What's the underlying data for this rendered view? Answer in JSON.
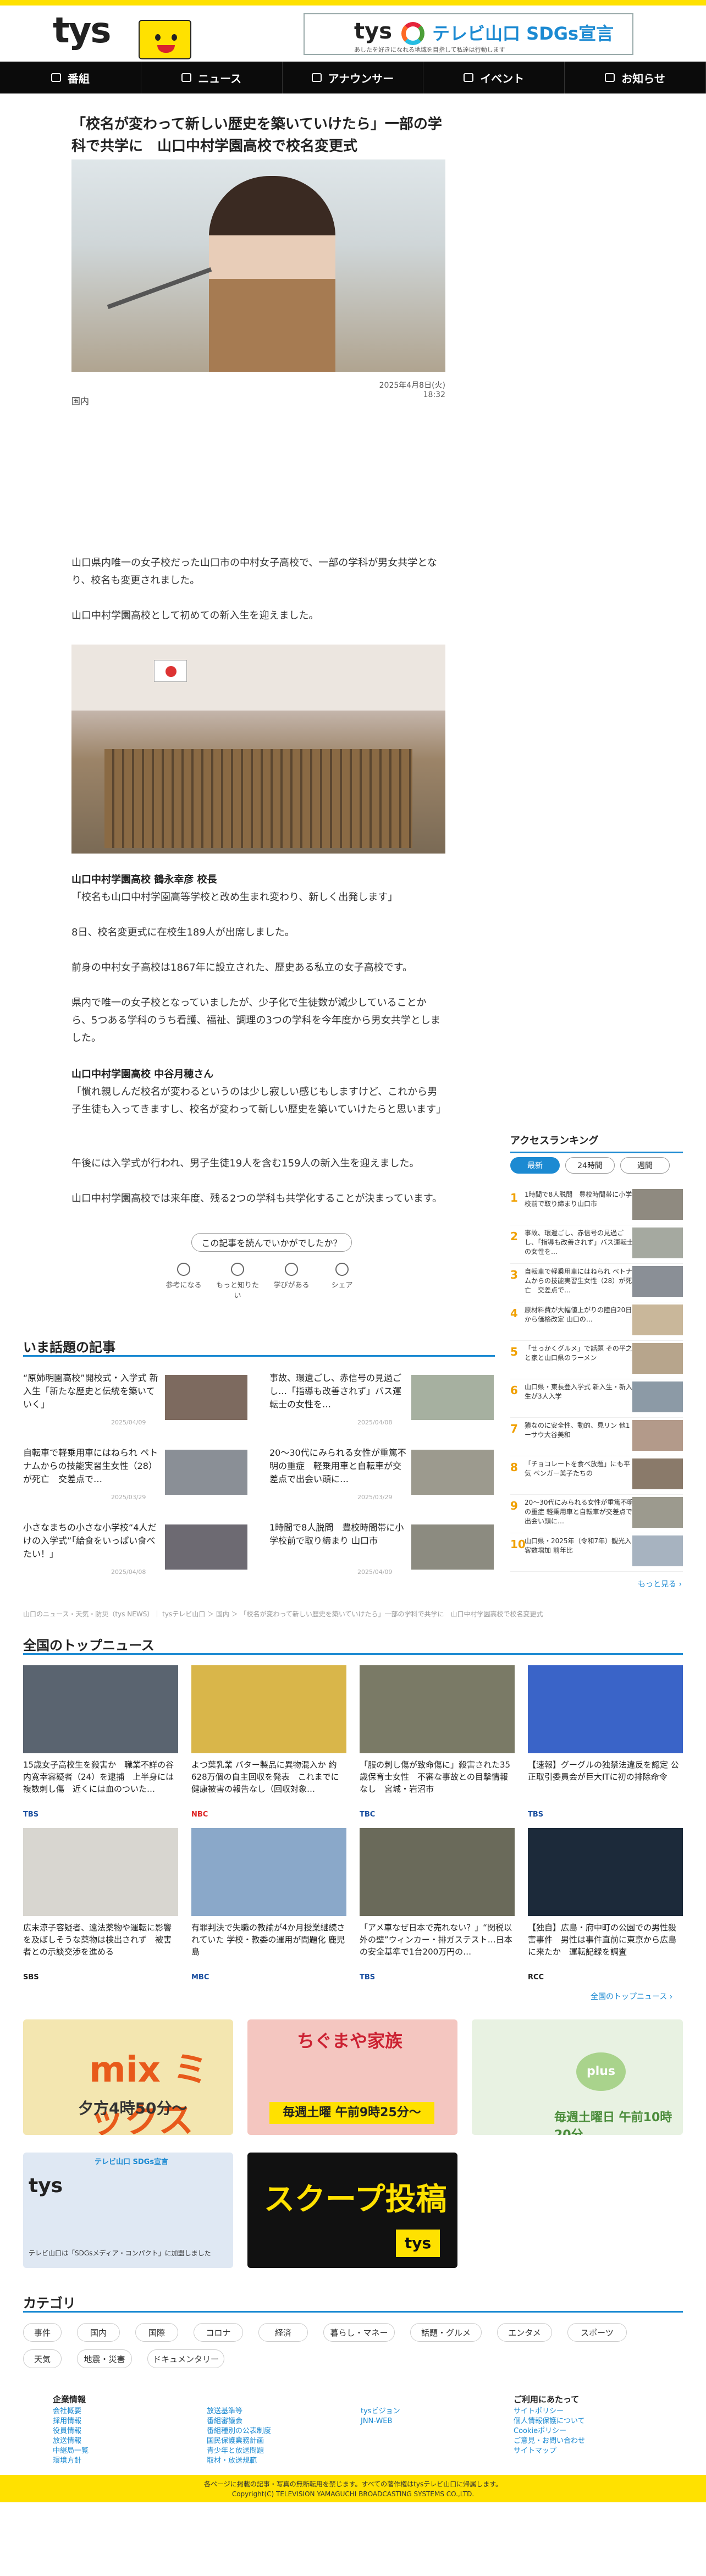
{
  "brand": {
    "logo": "tys",
    "sdgs_label": "テレビ山口 SDGs宣言",
    "sdgs_sub": "あしたを好きになれる地域を目指して私達は行動します",
    "accent": "#ffe100",
    "link": "#1c8ad2"
  },
  "nav": [
    "番組",
    "ニュース",
    "アナウンサー",
    "イベント",
    "お知らせ"
  ],
  "article": {
    "title": "「校名が変わって新しい歴史を築いていけたら」一部の学科で共学に　山口中村学園高校で校名変更式",
    "date": "2025年4月8日(火) 18:32",
    "category": "国内",
    "p1": "山口県内唯一の女子校だった山口市の中村女子高校で、一部の学科が男女共学となり、校名も変更されました。",
    "p2": "山口中村学園高校として初めての新入生を迎えました。",
    "speaker1": "山口中村学園高校 鶴永幸彦 校長",
    "q1": "「校名も山口中村学園高等学校と改め生まれ変わり、新しく出発します」",
    "p3": "8日、校名変更式に在校生189人が出席しました。",
    "p4": "前身の中村女子高校は1867年に設立された、歴史ある私立の女子高校です。",
    "p5": "県内で唯一の女子校となっていましたが、少子化で生徒数が減少していることから、5つある学科のうち看護、福祉、調理の3つの学科を今年度から男女共学としました。",
    "speaker2": "山口中村学園高校 中谷月穂さん",
    "q2": "「慣れ親しんだ校名が変わるというのは少し寂しい感じもしますけど、これから男子生徒も入ってきますし、校名が変わって新しい歴史を築いていけたらと思います」",
    "p6": "午後には入学式が行われ、男子生徒19人を含む159人の新入生を迎えました。",
    "p7": "山口中村学園高校では来年度、残る2つの学科も共学化することが決まっています。",
    "survey": "この記事を読んでいかがでしたか？",
    "reactions": [
      "参考になる",
      "もっと知りたい",
      "学びがある",
      "シェア"
    ]
  },
  "topics": {
    "title": "いま話題の記事",
    "items": [
      {
        "t": "“原姉明園高校”開校式・入学式 新入生「新たな歴史と伝統を築いていく」",
        "d": "2025/04/09"
      },
      {
        "t": "事故、環遺ごし、赤信号の見過ごし…「指導も改善されず」バス運転士の女性を…",
        "d": "2025/04/08"
      },
      {
        "t": "自転車で軽乗用車にはねられ ペトナムからの技能実習生女性（28）が死亡　交差点で…",
        "d": "2025/03/29"
      },
      {
        "t": "20～30代にみられる女性が重篤不明の重症　軽乗用車と自転車が交差点で出会い頭に…",
        "d": "2025/03/29"
      },
      {
        "t": "小さなまちの小さな小学校“4人だけの入学式”「給食をいっぱい食べたい！」",
        "d": "2025/04/08"
      },
      {
        "t": "1時間で8人脱問　豊校時間帯に小学校前で取り締まり 山口市",
        "d": "2025/04/09"
      }
    ]
  },
  "ranking": {
    "title": "アクセスランキング",
    "tabs": [
      "最新",
      "24時間",
      "週間"
    ],
    "more": "もっと見る ›",
    "items": [
      "1時間で8人脱問　豊校時間帯に小学校前で取り締まり山口市",
      "事故、環遺ごし、赤信号の見過ごし、「指導も改善されず」バス運転士の女性を…",
      "自転車で軽乗用車にはねられ ペトナムからの技能実習生女性（28）が死亡　交差点で…",
      "原材料費が大幅値上がりの陸自20日から価格改定 山口の…",
      "「せっかくグルメ」で話題 その平之と家と山口県のラーメン",
      "山口県・東長登入学式 新入生・新入生が3人入学",
      "猿なのに安全性、動的、見リン 他1ーサウ大谷美和",
      "「チョコレートを食べ放題」にも平気 ペンガー美子たちの",
      "20～30代にみられる女性が重篤不明の重症 軽乗用車と自転車が交差点で出会い頭に…",
      "山口県・2025年（令和7年）観光入客数増加 前年比"
    ]
  },
  "crumb": "山口のニュース・天気・防災（tys NEWS）｜ tysテレビ山口 ＞ 国内 ＞ 「校名が変わって新しい歴史を築いていけたら」一部の学科で共学に　山口中村学園高校で校名変更式",
  "national": {
    "title": "全国のトップニュース",
    "more": "全国のトップニュース ›",
    "items": [
      {
        "t": "15歳女子高校生を殺害か　職業不詳の谷内寛幸容疑者（24）を逮捕　上半身には複数刺し傷　近くには血のついた…",
        "s": "TBS",
        "c": "#1a4fa0"
      },
      {
        "t": "よつ葉乳業 バター製品に異物混入か 約628万個の自主回収を発表　これまでに健康被害の報告なし（回収対象…",
        "s": "NBC",
        "c": "#d22"
      },
      {
        "t": "「服の刺し傷が致命傷に」殺害された35歳保育士女性　不審な事故との目撃情報なし　宮城・岩沼市",
        "s": "TBC",
        "c": "#1a4fa0"
      },
      {
        "t": "【速報】グーグルの独禁法違反を認定 公正取引委員会が巨大ITに初の排除命令",
        "s": "TBS",
        "c": "#1a4fa0"
      },
      {
        "t": "広末涼子容疑者、遠法薬物や運転に影響を及ぼしそうな薬物は検出されず　被害者との示談交渉を進める",
        "s": "SBS",
        "c": "#222"
      },
      {
        "t": "有罪判決で失職の教諭が4か月授業継続されていた 学校・教委の運用が問題化 鹿児島",
        "s": "MBC",
        "c": "#1a4fa0"
      },
      {
        "t": "「アメ車なぜ日本で売れない？」“関税以外の壁”ウィンカー・排ガステスト…日本の安全基準で1台200万円の…",
        "s": "TBS",
        "c": "#1a4fa0"
      },
      {
        "t": "【独自】広島・府中町の公園での男性殺害事件　男性は事件直前に東京から広島に来たか　運転記録を調査",
        "s": "RCC",
        "c": "#222"
      }
    ]
  },
  "banners": [
    {
      "label": "mix ミックス",
      "sub": "夕方4時50分～",
      "bg": "#f3e6b0"
    },
    {
      "label": "ちぐまや家族",
      "sub": "毎週土曜 午前9時25分～",
      "bg": "#f4c6c0"
    },
    {
      "label": "plus",
      "sub": "毎週土曜日 午前10時20分",
      "bg": "#e8f2e2"
    },
    {
      "label": "テレビ山口 SDGs宣言",
      "sub": "テレビ山口は「SDGsメディア・コンパクト」に加盟しました",
      "bg": "#dfe8f3"
    },
    {
      "label": "スクープ投稿",
      "sub": "tys",
      "bg": "#ffe100"
    }
  ],
  "categories": {
    "title": "カテゴリ",
    "items": [
      "事件",
      "国内",
      "国際",
      "コロナ",
      "経済",
      "暮らし・マネー",
      "話題・グルメ",
      "エンタメ",
      "スポーツ",
      "天気",
      "地震・災害",
      "ドキュメンタリー"
    ]
  },
  "footer": {
    "c1": {
      "h": "企業情報",
      "items": [
        "会社概要",
        "採用情報",
        "役員情報",
        "放送情報",
        "中継局一覧",
        "環境方針"
      ]
    },
    "c2": {
      "items": [
        "放送基準等",
        "番組審議会",
        "番組種別の公表制度",
        "国民保護業務計画",
        "青少年と放送問題",
        "取材・放送規範"
      ]
    },
    "c3": {
      "items": [
        "tysビジョン",
        "JNN-WEB"
      ]
    },
    "c4": {
      "h": "ご利用にあたって",
      "items": [
        "サイトポリシー",
        "個人情報保護について",
        "Cookieポリシー",
        "ご意見・お問い合わせ",
        "サイトマップ"
      ]
    },
    "copy1": "各ページに掲載の記事・写真の無断転用を禁じます。すべての著作権はtysテレビ山口に帰属します。",
    "copy2": "Copyright(C) TELEVISION YAMAGUCHI BROADCASTING SYSTEMS CO.,LTD."
  }
}
